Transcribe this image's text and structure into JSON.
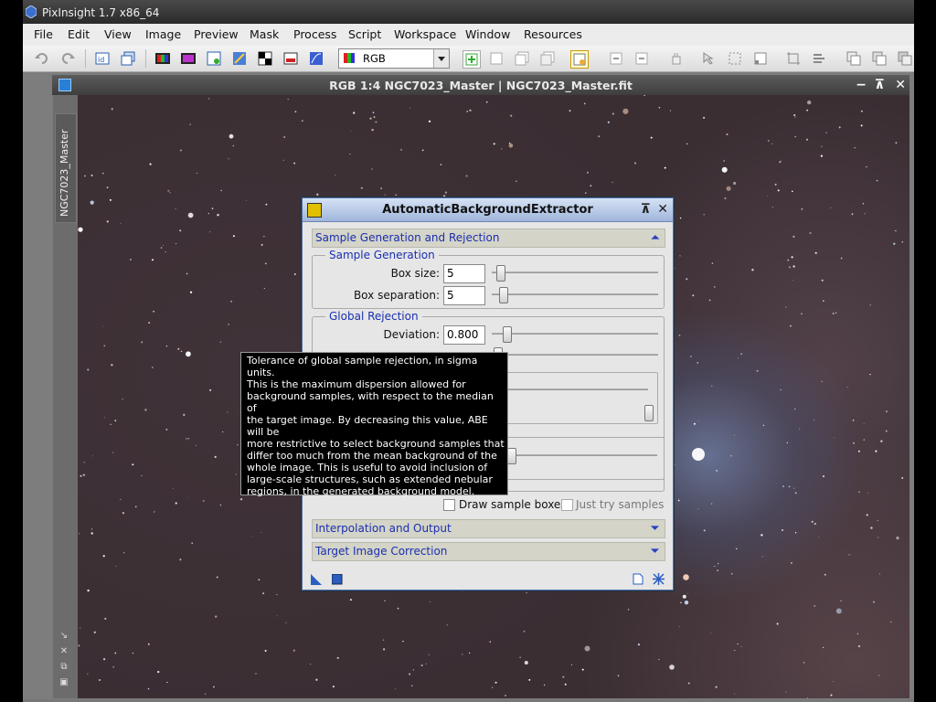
{
  "app": {
    "title": "PixInsight 1.7 x86_64"
  },
  "menu": [
    "File",
    "Edit",
    "View",
    "Image",
    "Preview",
    "Mask",
    "Process",
    "Script",
    "Workspace",
    "Window",
    "Resources"
  ],
  "toolbar": {
    "color_mode": "RGB"
  },
  "image_window": {
    "title": "RGB 1:4 NGC7023_Master | NGC7023_Master.fit",
    "tab_label": "NGC7023_Master",
    "controls": [
      "−",
      "⊼",
      "+",
      "✕"
    ]
  },
  "dialog": {
    "title": "AutomaticBackgroundExtractor",
    "section_sample": "Sample Generation and Rejection",
    "group_sample_generation": "Sample Generation",
    "box_size_label": "Box size:",
    "box_size_value": "5",
    "box_separation_label": "Box separation:",
    "box_separation_value": "5",
    "group_global_rejection": "Global Rejection",
    "deviation_label": "Deviation:",
    "deviation_value": "0.800",
    "draw_sample_boxes": "Draw sample boxes",
    "just_try_samples": "Just try samples",
    "section_interpolation": "Interpolation and Output",
    "section_target": "Target Image Correction"
  },
  "tooltip": {
    "line1": "Tolerance of global sample rejection, in sigma units.",
    "body_lines": [
      "This is the maximum dispersion allowed for",
      "background samples, with respect to the median of",
      "the target image. By decreasing this value, ABE will be",
      "more restrictive to select background samples that",
      "differ too much from the mean background of the",
      "whole image. This is useful to avoid inclusion of",
      "large-scale structures, such as extended nebular",
      "regions, in the generated background model."
    ]
  },
  "colors": {
    "accent_blue": "#1a2fb0",
    "title_gradient": "#9fb6dc"
  }
}
